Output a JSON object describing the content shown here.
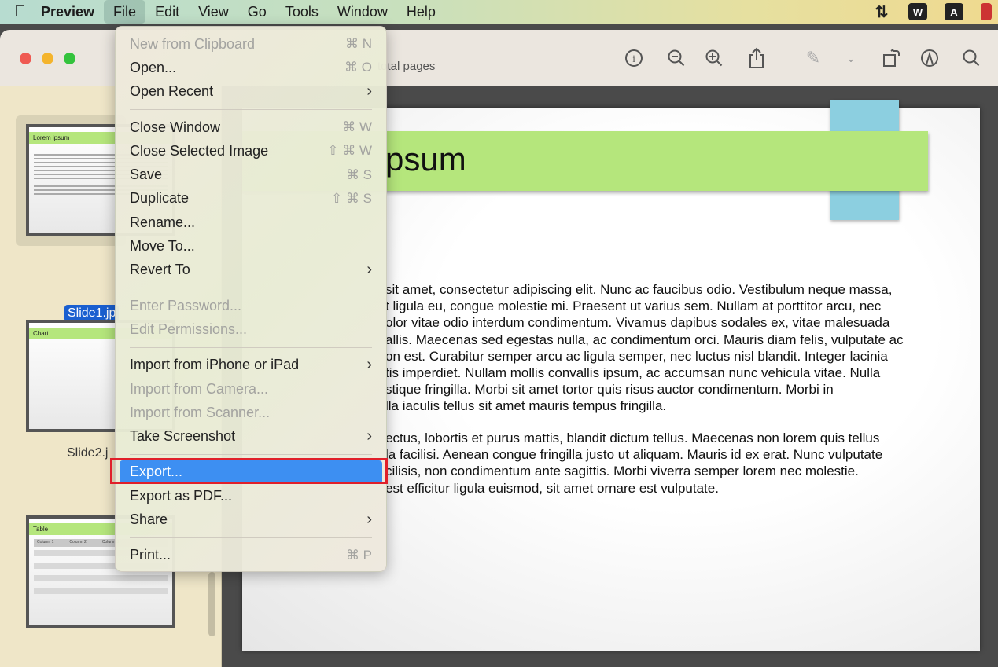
{
  "menubar": {
    "app": "Preview",
    "items": [
      "File",
      "Edit",
      "View",
      "Go",
      "Tools",
      "Window",
      "Help"
    ]
  },
  "toolbar": {
    "pages_text": "total pages",
    "icons": [
      "info-icon",
      "zoom-out-icon",
      "zoom-in-icon",
      "share-icon",
      "highlight-pen-icon",
      "chevron-down-icon",
      "rotate-icon",
      "markup-icon",
      "search-icon"
    ]
  },
  "sidebar": {
    "thumbs": [
      {
        "label": "Slide1.jp",
        "title": "Lorem ipsum",
        "selected": true
      },
      {
        "label": "Slide2.j",
        "title": "Chart"
      },
      {
        "label": "",
        "title": "Table",
        "columns": [
          "Column 1",
          "Column 2",
          "Column 3"
        ]
      }
    ]
  },
  "document": {
    "title": "psum",
    "para1": [
      "sit amet, consectetur adipiscing elit. Nunc ac faucibus odio. Vestibulum neque massa,",
      "t ligula eu, congue molestie mi. Praesent ut varius sem. Nullam at porttitor arcu, nec",
      "olor vitae odio interdum condimentum. Vivamus dapibus sodales ex, vitae malesuada",
      "allis. Maecenas sed egestas nulla, ac condimentum orci. Mauris diam felis, vulputate ac",
      "on est. Curabitur semper arcu ac ligula semper, nec luctus nisl blandit. Integer lacinia",
      "tis imperdiet. Nullam mollis convallis ipsum, ac accumsan nunc vehicula vitae. Nulla",
      "stique fringilla. Morbi sit amet tortor quis risus auctor condimentum. Morbi in",
      "lla iaculis tellus sit amet mauris tempus fringilla."
    ],
    "para2": [
      "ectus, lobortis et purus mattis, blandit dictum tellus. Maecenas non lorem quis tellus",
      "la facilisi. Aenean congue fringilla justo ut aliquam. Mauris id ex erat. Nunc vulputate",
      "cilisis, non condimentum ante sagittis. Morbi viverra semper lorem nec molestie.",
      "est efficitur ligula euismod, sit amet ornare est vulputate."
    ]
  },
  "file_menu": [
    {
      "label": "New from Clipboard",
      "shortcut": "⌘ N",
      "disabled": true
    },
    {
      "label": "Open...",
      "shortcut": "⌘ O"
    },
    {
      "label": "Open Recent",
      "submenu": true
    },
    {
      "sep": true
    },
    {
      "label": "Close Window",
      "shortcut": "⌘ W"
    },
    {
      "label": "Close Selected Image",
      "shortcut": "⇧ ⌘ W"
    },
    {
      "label": "Save",
      "shortcut": "⌘ S"
    },
    {
      "label": "Duplicate",
      "shortcut": "⇧ ⌘ S"
    },
    {
      "label": "Rename..."
    },
    {
      "label": "Move To..."
    },
    {
      "label": "Revert To",
      "submenu": true
    },
    {
      "sep": true
    },
    {
      "label": "Enter Password...",
      "disabled": true
    },
    {
      "label": "Edit Permissions...",
      "disabled": true
    },
    {
      "sep": true
    },
    {
      "label": "Import from iPhone or iPad",
      "submenu": true
    },
    {
      "label": "Import from Camera...",
      "disabled": true
    },
    {
      "label": "Import from Scanner...",
      "disabled": true
    },
    {
      "label": "Take Screenshot",
      "submenu": true
    },
    {
      "sep": true
    },
    {
      "label": "Export...",
      "highlighted": true
    },
    {
      "label": "Export as PDF..."
    },
    {
      "label": "Share",
      "submenu": true
    },
    {
      "sep": true
    },
    {
      "label": "Print...",
      "shortcut": "⌘ P"
    }
  ],
  "colors": {
    "highlight": "#3d8ff2",
    "annotation_box": "#e0202a",
    "banner": "#b5e67c",
    "tab": "#8ccfe0",
    "selection": "#1a5fd0"
  }
}
